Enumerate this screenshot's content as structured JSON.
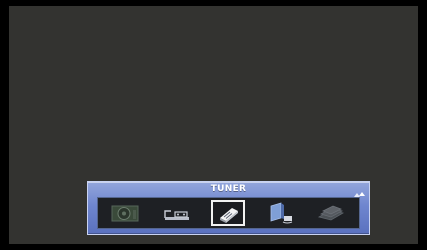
{
  "menu": {
    "title": "TUNER",
    "selected_index": 2,
    "items": [
      {
        "icon": "disc-player-icon",
        "state": "dim"
      },
      {
        "icon": "video-deck-icon",
        "state": "normal"
      },
      {
        "icon": "tuner-icon",
        "state": "selected"
      },
      {
        "icon": "network-media-icon",
        "state": "normal"
      },
      {
        "icon": "media-stack-icon",
        "state": "dim"
      }
    ]
  },
  "colors": {
    "screen_background": "#333330",
    "panel_blue": "#6f86cf",
    "strip_background": "#1e2024",
    "selection_border": "#f2f2f2"
  }
}
